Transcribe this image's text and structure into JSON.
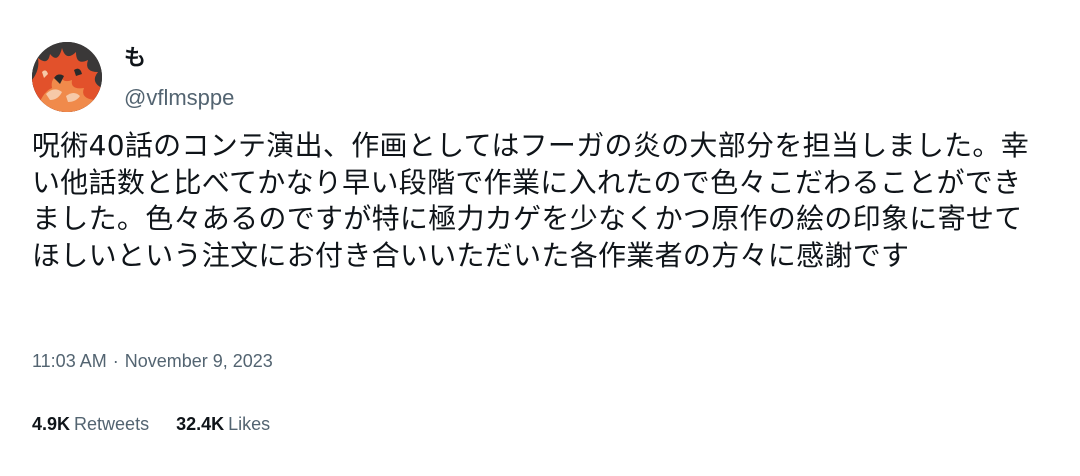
{
  "tweet": {
    "author": {
      "display_name": "も",
      "handle": "@vflmsppe",
      "avatar_icon": "avatar-image"
    },
    "text": "呪術40話のコンテ演出、作画としてはフーガの炎の大部分を担当しました。幸い他話数と比べてかなり早い段階で作業に入れたので色々こだわることができました。色々あるのですが特に極力カゲを少なくかつ原作の絵の印象に寄せてほしいという注文にお付き合いいただいた各作業者の方々に感謝です",
    "time": "11:03 AM",
    "separator": "·",
    "date": "November 9, 2023",
    "stats": {
      "retweets_count": "4.9K",
      "retweets_label": "Retweets",
      "likes_count": "32.4K",
      "likes_label": "Likes"
    }
  },
  "colors": {
    "text_primary": "#0f1419",
    "text_secondary": "#536471",
    "background": "#ffffff"
  }
}
